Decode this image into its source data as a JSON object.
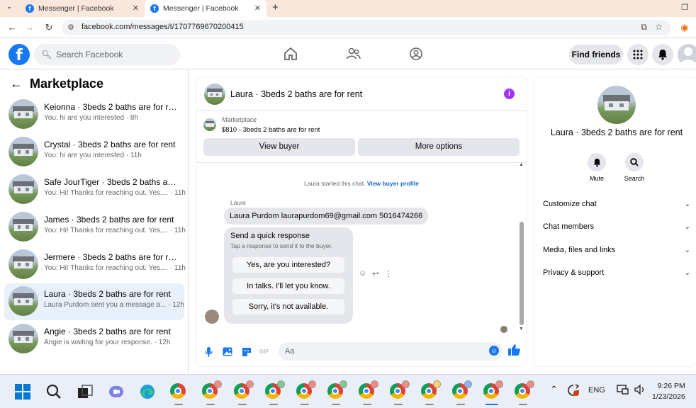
{
  "browser": {
    "tabs": [
      {
        "title": "Messenger | Facebook",
        "active": false
      },
      {
        "title": "Messenger | Facebook",
        "active": true
      }
    ],
    "url": "facebook.com/messages/t/1707769670200415"
  },
  "header": {
    "logo": "f",
    "search_placeholder": "Search Facebook",
    "find_friends": "Find friends"
  },
  "sidebar": {
    "title": "Marketplace",
    "conversations": [
      {
        "name": "Keionna · 3beds 2 baths are for rent",
        "preview": "You: hi are you interested · 8h",
        "active": false
      },
      {
        "name": "Crystal · 3beds 2 baths are for rent",
        "preview": "You: hi are you interested · 11h",
        "active": false
      },
      {
        "name": "Safe JourTiger · 3beds 2 baths are ...",
        "preview": "You: Hi! Thanks for reaching out. Yes,... · 11h",
        "active": false
      },
      {
        "name": "James · 3beds 2 baths are for rent",
        "preview": "You: Hi! Thanks for reaching out. Yes,... · 11h",
        "active": false
      },
      {
        "name": "Jermere · 3beds 2 baths are for rent",
        "preview": "You: Hi! Thanks for reaching out. Yes,... · 11h",
        "active": false
      },
      {
        "name": "Laura · 3beds 2 baths are for rent",
        "preview": "Laura Purdom sent you a message a... · 12h",
        "active": true
      },
      {
        "name": "Angie · 3beds 2 baths are for rent",
        "preview": "Angie is waiting for your response. · 12h",
        "active": false
      }
    ]
  },
  "chat": {
    "title": "Laura · 3beds 2 baths are for rent",
    "marketplace_label": "Marketplace",
    "listing": "$810 - 3beds 2 baths are for rent",
    "view_buyer": "View buyer",
    "more_options": "More options",
    "started_text": "Laura started this chat.",
    "view_profile": "View buyer profile",
    "sender_name": "Laura",
    "message": "Laura Purdom laurapurdom69@gmail.com 5016474266",
    "quick_title": "Send a quick response",
    "quick_subtitle": "Tap a response to send it to the buyer.",
    "quick_replies": [
      "Yes, are you interested?",
      "In talks. I'll let you know.",
      "Sorry, it's not available."
    ],
    "composer_placeholder": "Aa"
  },
  "info": {
    "name": "Laura · 3beds 2 baths are for rent",
    "mute": "Mute",
    "search": "Search",
    "sections": [
      "Customize chat",
      "Chat members",
      "Media, files and links",
      "Privacy & support"
    ]
  },
  "taskbar": {
    "language": "ENG",
    "time": "9:26 PM",
    "date": "1/23/2026"
  },
  "colors": {
    "accent": "#1877f2",
    "active_row": "#e7f0fb",
    "info_icon": "#a033ff"
  }
}
